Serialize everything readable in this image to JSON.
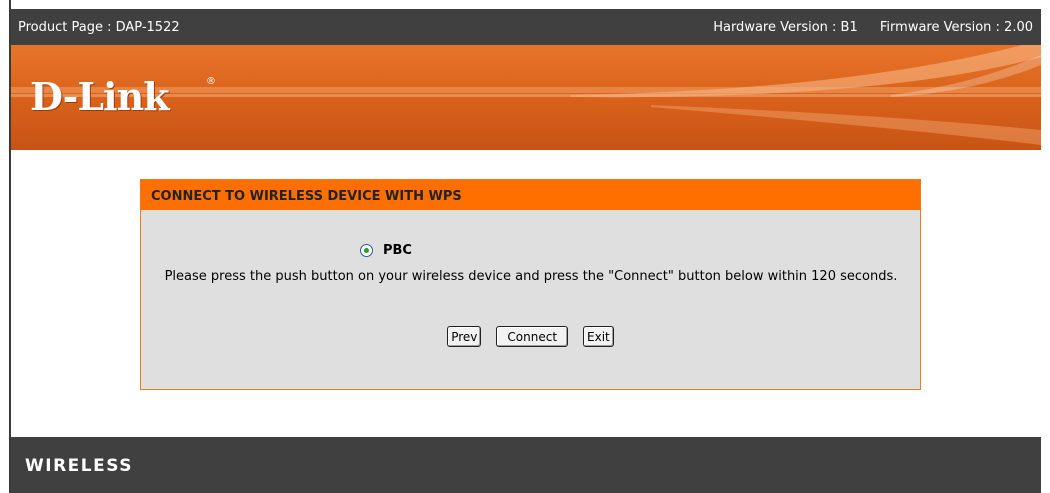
{
  "header": {
    "product_page": "Product Page : DAP-1522",
    "hardware_version": "Hardware Version : B1",
    "firmware_version": "Firmware Version : 2.00"
  },
  "brand": {
    "logo_text": "D-Link",
    "registered_mark": "®",
    "accent_color": "#e8742a"
  },
  "wps_panel": {
    "title": "CONNECT TO WIRELESS DEVICE WITH WPS",
    "option_label": "PBC",
    "option_selected": true,
    "instructions": "Please press the push button on your wireless device and press the \"Connect\" button below within 120 seconds.",
    "buttons": {
      "prev": "Prev",
      "connect": "Connect",
      "exit": "Exit"
    }
  },
  "footer": {
    "label": "WIRELESS"
  }
}
